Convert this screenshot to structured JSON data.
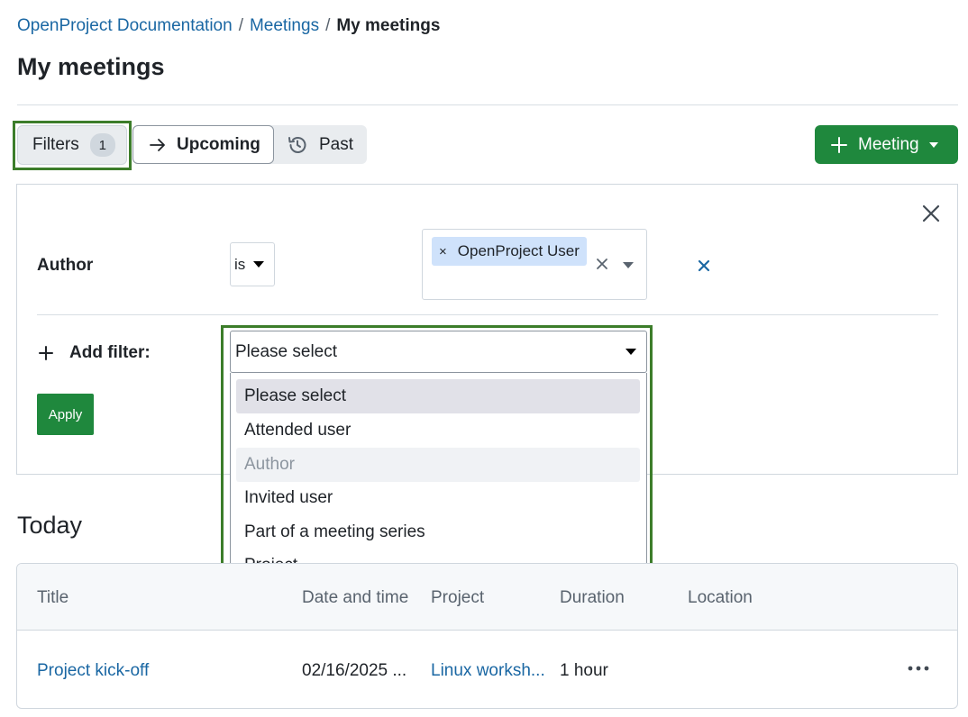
{
  "breadcrumb": {
    "items": [
      "OpenProject Documentation",
      "Meetings"
    ],
    "separator": "/",
    "current": "My meetings"
  },
  "page": {
    "title": "My meetings"
  },
  "toolbar": {
    "filters_label": "Filters",
    "filters_count": "1",
    "upcoming_label": "Upcoming",
    "past_label": "Past",
    "meeting_button_label": "Meeting"
  },
  "filters": {
    "author": {
      "label": "Author",
      "operator": "is",
      "chip_remove": "×",
      "value": "OpenProject User"
    },
    "add_filter_label": "Add filter:",
    "select_value": "Please select",
    "options": [
      "Please select",
      "Attended user",
      "Author",
      "Invited user",
      "Part of a meeting series",
      "Project"
    ],
    "apply_label": "Apply"
  },
  "section": {
    "today_label": "Today"
  },
  "table": {
    "headers": [
      "Title",
      "Date and time",
      "Project",
      "Duration",
      "Location"
    ],
    "rows": [
      {
        "title": "Project kick-off",
        "date": "02/16/2025 ...",
        "project": "Linux worksh...",
        "duration": "1 hour",
        "location": ""
      }
    ]
  },
  "colors": {
    "accent_green": "#1f883d",
    "link_blue": "#1a67a3",
    "highlight_outline": "#3c7d2a",
    "chip_bg": "#cfe2fb"
  },
  "icons": {
    "upcoming": "arrow-right-icon",
    "past": "history-icon",
    "meeting": "plus-icon",
    "close": "close-icon",
    "add": "plus-icon",
    "row_menu": "kebab-horizontal-icon"
  }
}
